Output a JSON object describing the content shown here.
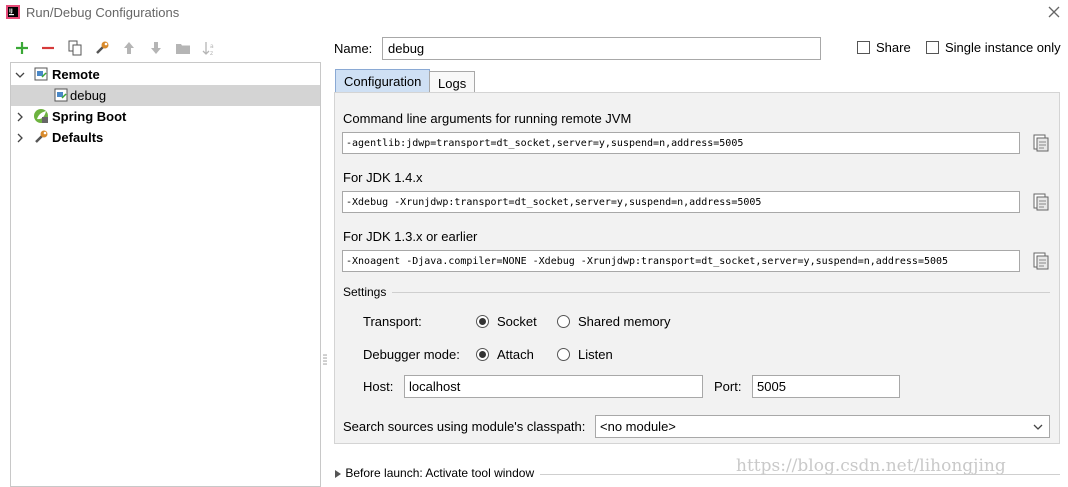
{
  "window": {
    "title": "Run/Debug Configurations"
  },
  "toolbar": {
    "icons": [
      "add-icon",
      "remove-icon",
      "copy-icon",
      "wrench-icon",
      "move-up-icon",
      "move-down-icon",
      "folder-icon",
      "sort-icon"
    ],
    "colors": {
      "add": "#3aa836",
      "remove": "#d63b3b"
    }
  },
  "tree": {
    "remote": "Remote",
    "debug": "debug",
    "spring_boot": "Spring Boot",
    "defaults": "Defaults"
  },
  "name_field": {
    "label": "Name:",
    "value": "debug"
  },
  "share": {
    "label": "Share",
    "checked": false
  },
  "single_instance": {
    "label": "Single instance only",
    "checked": false
  },
  "tabs": [
    {
      "label": "Configuration",
      "active": true
    },
    {
      "label": "Logs",
      "active": false
    }
  ],
  "config": {
    "cmd_label": "Command line arguments for running remote JVM",
    "cmd_value": "-agentlib:jdwp=transport=dt_socket,server=y,suspend=n,address=5005",
    "jdk14_label": "For JDK 1.4.x",
    "jdk14_value": "-Xdebug -Xrunjdwp:transport=dt_socket,server=y,suspend=n,address=5005",
    "jdk13_label": "For JDK 1.3.x or earlier",
    "jdk13_value": "-Xnoagent -Djava.compiler=NONE -Xdebug -Xrunjdwp:transport=dt_socket,server=y,suspend=n,address=5005",
    "settings_label": "Settings",
    "transport_label": "Transport:",
    "transport_socket": "Socket",
    "transport_shared": "Shared memory",
    "debugger_label": "Debugger mode:",
    "debugger_attach": "Attach",
    "debugger_listen": "Listen",
    "host_label": "Host:",
    "host_value": "localhost",
    "port_label": "Port:",
    "port_value": "5005",
    "classpath_label": "Search sources using module's classpath:",
    "classpath_value": "<no module>"
  },
  "before_launch": {
    "label": "Before launch: Activate tool window"
  },
  "watermark": "https://blog.csdn.net/lihongjing"
}
